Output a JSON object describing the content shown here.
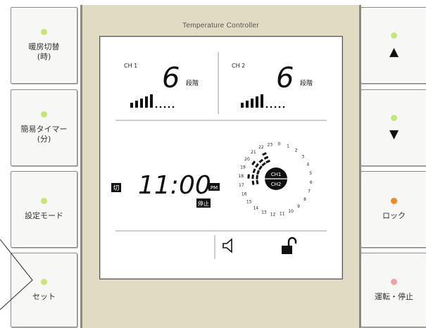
{
  "panel": {
    "title": "Temperature Controller"
  },
  "left_buttons": [
    {
      "label": "暖房切替\n(時)",
      "led_color": "#c6e67a"
    },
    {
      "label": "簡易タイマー\n(分)",
      "led_color": "#c6e67a"
    },
    {
      "label": "設定モード",
      "led_color": "#c6e67a"
    },
    {
      "label": "セット",
      "led_color": "#c6e67a"
    }
  ],
  "right_buttons": [
    {
      "arrow": "▲",
      "label": "",
      "led_color": "#c6e67a"
    },
    {
      "arrow": "▼",
      "label": "",
      "led_color": "#c6e67a"
    },
    {
      "arrow": "",
      "label": "ロック",
      "led_color": "#f08a24"
    },
    {
      "arrow": "",
      "label": "運転・停止",
      "led_color": "#f2a0a8"
    }
  ],
  "display": {
    "ch1": {
      "label": "CH 1",
      "level": "6",
      "unit": "段階"
    },
    "ch2": {
      "label": "CH 2",
      "level": "6",
      "unit": "段階"
    },
    "off_badge": "切",
    "time": "11:00",
    "pm": "PM",
    "scheduled_badge": "停止",
    "dial_ch1": "CH1",
    "dial_ch2": "CH2",
    "dial_numbers": [
      "23",
      "0",
      "1",
      "2",
      "3",
      "4",
      "5",
      "6",
      "7",
      "8",
      "9",
      "10",
      "11",
      "12",
      "13",
      "14",
      "15",
      "16",
      "17",
      "18",
      "19",
      "20",
      "21",
      "22"
    ],
    "speaker_icon": "speaker-icon",
    "lock_icon": "unlocked-padlock-icon"
  }
}
